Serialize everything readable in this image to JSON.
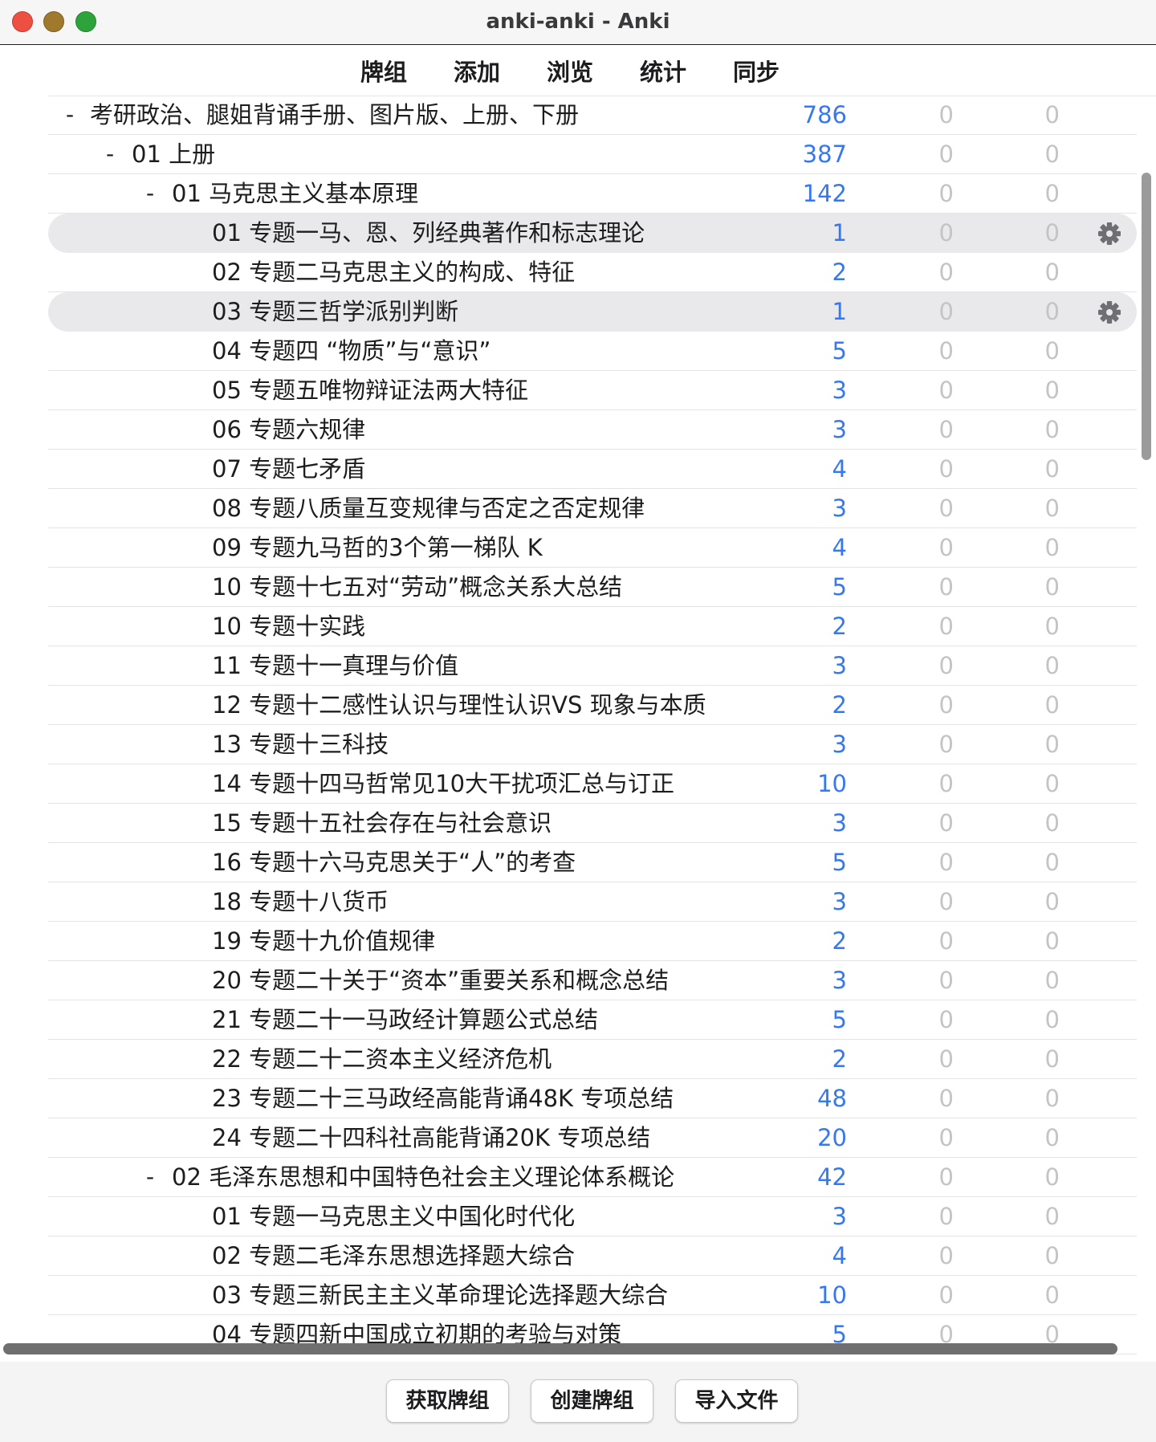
{
  "window": {
    "title": "anki-anki - Anki"
  },
  "toolbar": {
    "items": [
      "牌组",
      "添加",
      "浏览",
      "统计",
      "同步"
    ]
  },
  "decks": [
    {
      "level": 0,
      "collapse": "-",
      "name": "考研政治、腿姐背诵手册、图片版、上册、下册",
      "new": "786",
      "learn": "0",
      "due": "0",
      "highlight": false,
      "gear": false
    },
    {
      "level": 1,
      "collapse": "-",
      "name": "01 上册",
      "new": "387",
      "learn": "0",
      "due": "0",
      "highlight": false,
      "gear": false
    },
    {
      "level": 2,
      "collapse": "-",
      "name": "01 马克思主义基本原理",
      "new": "142",
      "learn": "0",
      "due": "0",
      "highlight": false,
      "gear": false
    },
    {
      "level": 3,
      "collapse": "",
      "name": "01 专题一马、恩、列经典著作和标志理论",
      "new": "1",
      "learn": "0",
      "due": "0",
      "highlight": true,
      "gear": true
    },
    {
      "level": 3,
      "collapse": "",
      "name": "02 专题二马克思主义的构成、特征",
      "new": "2",
      "learn": "0",
      "due": "0",
      "highlight": false,
      "gear": false
    },
    {
      "level": 3,
      "collapse": "",
      "name": "03 专题三哲学派别判断",
      "new": "1",
      "learn": "0",
      "due": "0",
      "highlight": true,
      "gear": true
    },
    {
      "level": 3,
      "collapse": "",
      "name": "04 专题四 “物质”与“意识”",
      "new": "5",
      "learn": "0",
      "due": "0",
      "highlight": false,
      "gear": false
    },
    {
      "level": 3,
      "collapse": "",
      "name": "05 专题五唯物辩证法两大特征",
      "new": "3",
      "learn": "0",
      "due": "0",
      "highlight": false,
      "gear": false
    },
    {
      "level": 3,
      "collapse": "",
      "name": "06 专题六规律",
      "new": "3",
      "learn": "0",
      "due": "0",
      "highlight": false,
      "gear": false
    },
    {
      "level": 3,
      "collapse": "",
      "name": "07 专题七矛盾",
      "new": "4",
      "learn": "0",
      "due": "0",
      "highlight": false,
      "gear": false
    },
    {
      "level": 3,
      "collapse": "",
      "name": "08 专题八质量互变规律与否定之否定规律",
      "new": "3",
      "learn": "0",
      "due": "0",
      "highlight": false,
      "gear": false
    },
    {
      "level": 3,
      "collapse": "",
      "name": "09 专题九马哲的3个第一梯队 K",
      "new": "4",
      "learn": "0",
      "due": "0",
      "highlight": false,
      "gear": false
    },
    {
      "level": 3,
      "collapse": "",
      "name": "10 专题十七五对“劳动”概念关系大总结",
      "new": "5",
      "learn": "0",
      "due": "0",
      "highlight": false,
      "gear": false
    },
    {
      "level": 3,
      "collapse": "",
      "name": "10 专题十实践",
      "new": "2",
      "learn": "0",
      "due": "0",
      "highlight": false,
      "gear": false
    },
    {
      "level": 3,
      "collapse": "",
      "name": "11 专题十一真理与价值",
      "new": "3",
      "learn": "0",
      "due": "0",
      "highlight": false,
      "gear": false
    },
    {
      "level": 3,
      "collapse": "",
      "name": "12 专题十二感性认识与理性认识VS 现象与本质",
      "new": "2",
      "learn": "0",
      "due": "0",
      "highlight": false,
      "gear": false
    },
    {
      "level": 3,
      "collapse": "",
      "name": "13 专题十三科技",
      "new": "3",
      "learn": "0",
      "due": "0",
      "highlight": false,
      "gear": false
    },
    {
      "level": 3,
      "collapse": "",
      "name": "14 专题十四马哲常见10大干扰项汇总与订正",
      "new": "10",
      "learn": "0",
      "due": "0",
      "highlight": false,
      "gear": false
    },
    {
      "level": 3,
      "collapse": "",
      "name": "15 专题十五社会存在与社会意识",
      "new": "3",
      "learn": "0",
      "due": "0",
      "highlight": false,
      "gear": false
    },
    {
      "level": 3,
      "collapse": "",
      "name": "16 专题十六马克思关于“人”的考查",
      "new": "5",
      "learn": "0",
      "due": "0",
      "highlight": false,
      "gear": false
    },
    {
      "level": 3,
      "collapse": "",
      "name": "18 专题十八货币",
      "new": "3",
      "learn": "0",
      "due": "0",
      "highlight": false,
      "gear": false
    },
    {
      "level": 3,
      "collapse": "",
      "name": "19 专题十九价值规律",
      "new": "2",
      "learn": "0",
      "due": "0",
      "highlight": false,
      "gear": false
    },
    {
      "level": 3,
      "collapse": "",
      "name": "20 专题二十关于“资本”重要关系和概念总结",
      "new": "3",
      "learn": "0",
      "due": "0",
      "highlight": false,
      "gear": false
    },
    {
      "level": 3,
      "collapse": "",
      "name": "21 专题二十一马政经计算题公式总结",
      "new": "5",
      "learn": "0",
      "due": "0",
      "highlight": false,
      "gear": false
    },
    {
      "level": 3,
      "collapse": "",
      "name": "22 专题二十二资本主义经济危机",
      "new": "2",
      "learn": "0",
      "due": "0",
      "highlight": false,
      "gear": false
    },
    {
      "level": 3,
      "collapse": "",
      "name": "23 专题二十三马政经高能背诵48K 专项总结",
      "new": "48",
      "learn": "0",
      "due": "0",
      "highlight": false,
      "gear": false
    },
    {
      "level": 3,
      "collapse": "",
      "name": "24 专题二十四科社高能背诵20K 专项总结",
      "new": "20",
      "learn": "0",
      "due": "0",
      "highlight": false,
      "gear": false
    },
    {
      "level": 2,
      "collapse": "-",
      "name": "02 毛泽东思想和中国特色社会主义理论体系概论",
      "new": "42",
      "learn": "0",
      "due": "0",
      "highlight": false,
      "gear": false
    },
    {
      "level": 3,
      "collapse": "",
      "name": "01 专题一马克思主义中国化时代化",
      "new": "3",
      "learn": "0",
      "due": "0",
      "highlight": false,
      "gear": false
    },
    {
      "level": 3,
      "collapse": "",
      "name": "02 专题二毛泽东思想选择题大综合",
      "new": "4",
      "learn": "0",
      "due": "0",
      "highlight": false,
      "gear": false
    },
    {
      "level": 3,
      "collapse": "",
      "name": "03 专题三新民主主义革命理论选择题大综合",
      "new": "10",
      "learn": "0",
      "due": "0",
      "highlight": false,
      "gear": false
    },
    {
      "level": 3,
      "collapse": "",
      "name": "04 专题四新中国成立初期的考验与对策",
      "new": "5",
      "learn": "0",
      "due": "0",
      "highlight": false,
      "gear": false
    }
  ],
  "buttons": {
    "get_shared": "获取牌组",
    "create_deck": "创建牌组",
    "import_file": "导入文件"
  },
  "colors": {
    "new_count": "#3478f6",
    "zero_count": "#c4c4c4",
    "highlight": "#e9e9eb"
  }
}
